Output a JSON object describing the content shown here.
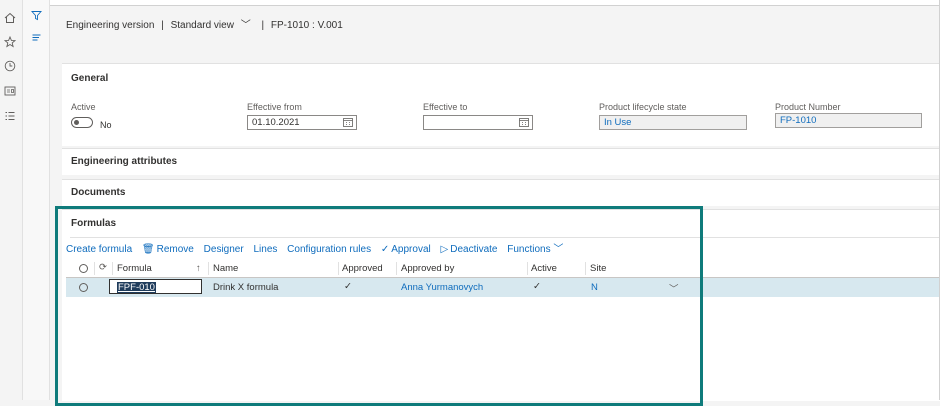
{
  "breadcrumb": {
    "part1": "Engineering version",
    "sep": "|",
    "view": "Standard view",
    "sep2": "|",
    "record": "FP-1010 : V.001"
  },
  "icons": {
    "rail": [
      "home-icon",
      "star-icon",
      "clock-icon",
      "dashboard-icon",
      "list-icon"
    ],
    "secondary": [
      "filter-icon",
      "hamburger-icon"
    ]
  },
  "general": {
    "title": "General",
    "active_label": "Active",
    "active_value": "No",
    "effective_from_label": "Effective from",
    "effective_from_value": "01.10.2021",
    "effective_to_label": "Effective to",
    "effective_to_value": "",
    "lifecycle_label": "Product lifecycle state",
    "lifecycle_value": "In Use",
    "product_number_label": "Product Number",
    "product_number_value": "FP-1010"
  },
  "engineering_attributes": {
    "title": "Engineering attributes"
  },
  "documents": {
    "title": "Documents"
  },
  "formulas": {
    "title": "Formulas",
    "actions": {
      "create": "Create formula",
      "remove": "Remove",
      "designer": "Designer",
      "lines": "Lines",
      "config_rules": "Configuration rules",
      "approval": "Approval",
      "deactivate": "Deactivate",
      "functions": "Functions"
    },
    "columns": {
      "formula": "Formula",
      "name": "Name",
      "approved": "Approved",
      "approved_by": "Approved by",
      "active": "Active",
      "site": "Site"
    },
    "rows": [
      {
        "formula": "FPF-010",
        "name": "Drink X formula",
        "approved": "✓",
        "approved_by": "Anna Yurmanovych",
        "active": "✓",
        "site": "N"
      }
    ]
  },
  "colors": {
    "accent": "#0f6cbd",
    "highlight_border": "#0f7b7b",
    "selected_row": "#d7e8ef"
  }
}
